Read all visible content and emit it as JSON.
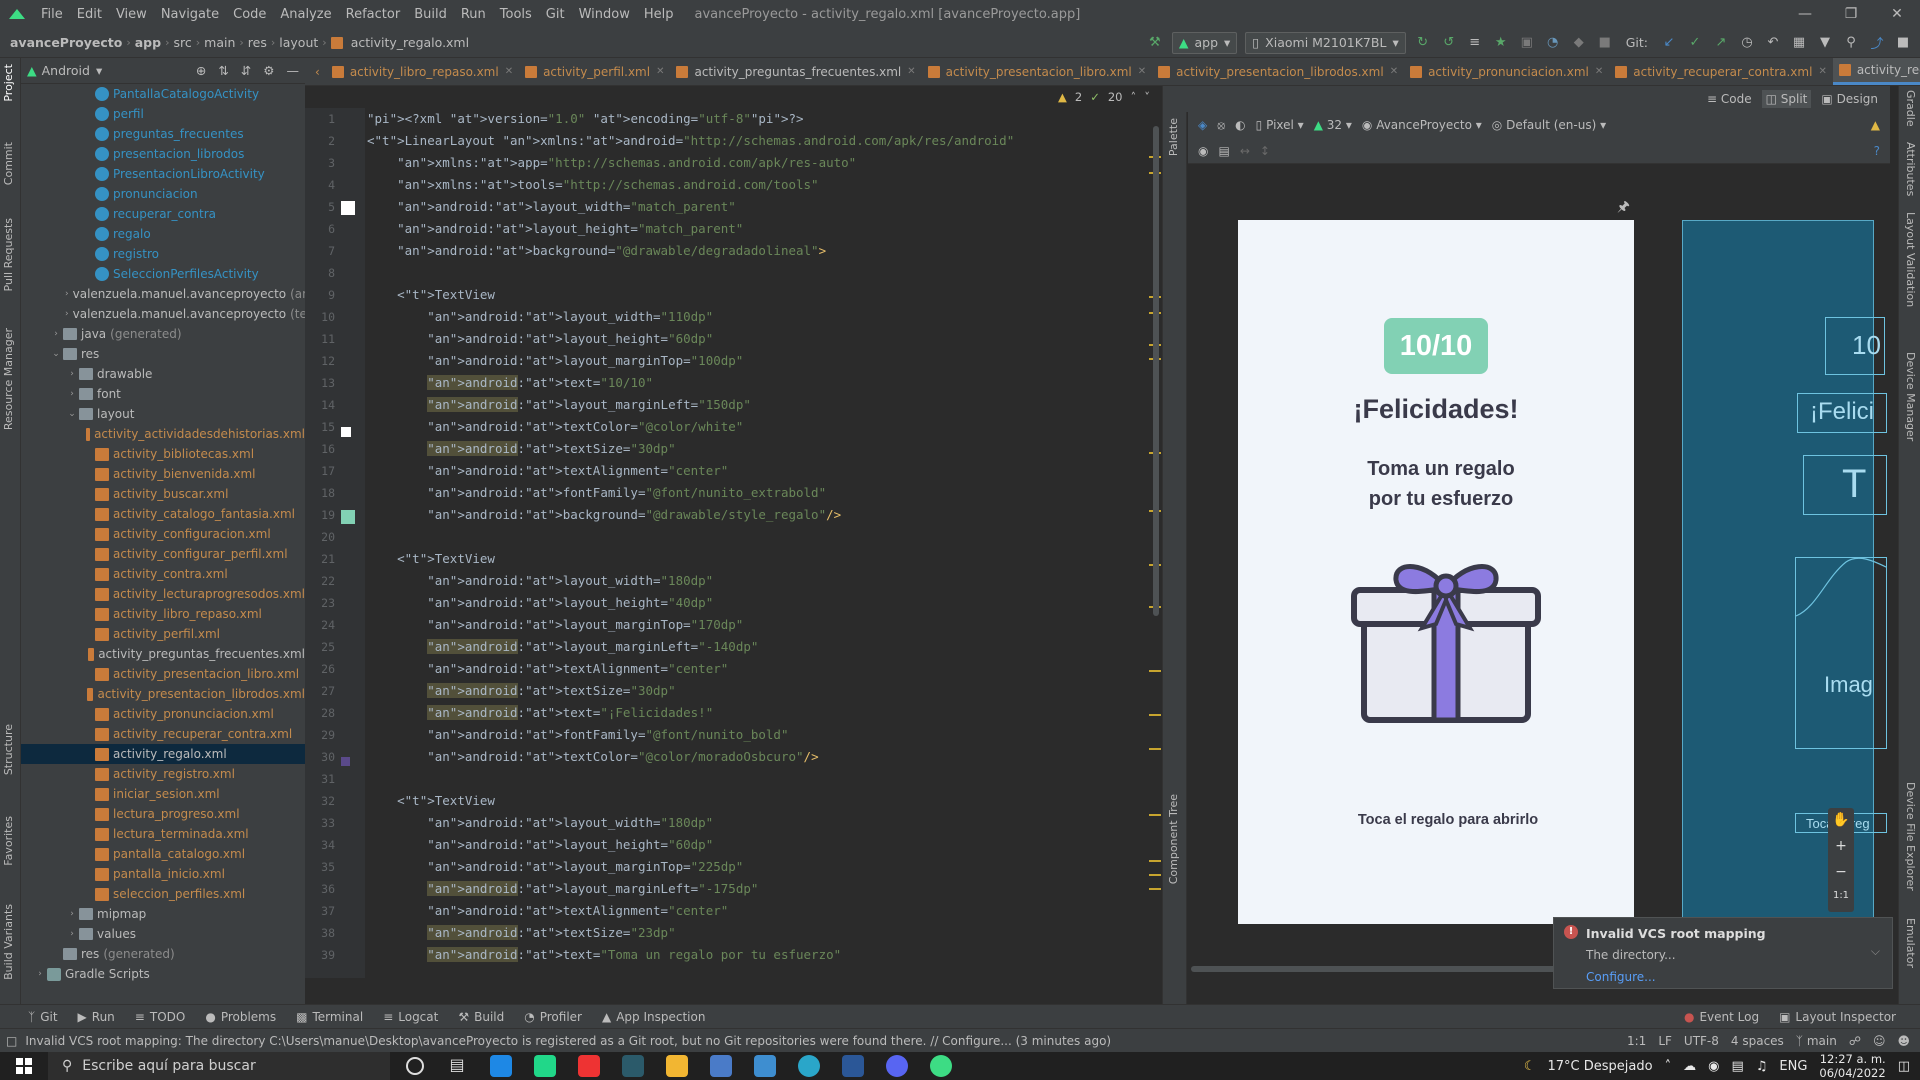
{
  "menubar": {
    "items": [
      "File",
      "Edit",
      "View",
      "Navigate",
      "Code",
      "Analyze",
      "Refactor",
      "Build",
      "Run",
      "Tools",
      "Git",
      "Window",
      "Help"
    ],
    "title": "avanceProyecto - activity_regalo.xml [avanceProyecto.app]"
  },
  "navbar": {
    "breadcrumbs": [
      "avanceProyecto",
      "app",
      "src",
      "main",
      "res",
      "layout",
      "activity_regalo.xml"
    ],
    "run_config": "app",
    "device": "Xiaomi M2101K7BL",
    "git_label": "Git:"
  },
  "left_stripe": [
    "Project",
    "Commit",
    "Pull Requests",
    "Resource Manager",
    "Structure",
    "Favorites",
    "Build Variants"
  ],
  "project": {
    "view": "Android",
    "tree": [
      {
        "label": "PantallaCatalogoActivity",
        "kind": "activity",
        "indent": 4
      },
      {
        "label": "perfil",
        "kind": "activity",
        "indent": 4
      },
      {
        "label": "preguntas_frecuentes",
        "kind": "activity",
        "indent": 4
      },
      {
        "label": "presentacion_librodos",
        "kind": "activity",
        "indent": 4
      },
      {
        "label": "PresentacionLibroActivity",
        "kind": "activity",
        "indent": 4
      },
      {
        "label": "pronunciacion",
        "kind": "activity",
        "indent": 4
      },
      {
        "label": "recuperar_contra",
        "kind": "activity",
        "indent": 4
      },
      {
        "label": "regalo",
        "kind": "activity",
        "indent": 4
      },
      {
        "label": "registro",
        "kind": "activity",
        "indent": 4
      },
      {
        "label": "SeleccionPerfilesActivity",
        "kind": "activity",
        "indent": 4
      },
      {
        "label": "valenzuela.manuel.avanceproyecto",
        "suffix": "(an",
        "kind": "package",
        "indent": 3,
        "arrow": "›"
      },
      {
        "label": "valenzuela.manuel.avanceproyecto",
        "suffix": "(te",
        "kind": "package",
        "indent": 3,
        "arrow": "›"
      },
      {
        "label": "java",
        "suffix": "(generated)",
        "kind": "folder",
        "indent": 2,
        "arrow": "›"
      },
      {
        "label": "res",
        "kind": "folder",
        "indent": 2,
        "arrow": "⌄"
      },
      {
        "label": "drawable",
        "kind": "folder",
        "indent": 3,
        "arrow": "›"
      },
      {
        "label": "font",
        "kind": "folder",
        "indent": 3,
        "arrow": "›"
      },
      {
        "label": "layout",
        "kind": "folder",
        "indent": 3,
        "arrow": "⌄"
      },
      {
        "label": "activity_actividadesdehistorias.xml",
        "kind": "xml",
        "indent": 4
      },
      {
        "label": "activity_bibliotecas.xml",
        "kind": "xml",
        "indent": 4
      },
      {
        "label": "activity_bienvenida.xml",
        "kind": "xml",
        "indent": 4
      },
      {
        "label": "activity_buscar.xml",
        "kind": "xml",
        "indent": 4
      },
      {
        "label": "activity_catalogo_fantasia.xml",
        "kind": "xml",
        "indent": 4
      },
      {
        "label": "activity_configuracion.xml",
        "kind": "xml",
        "indent": 4
      },
      {
        "label": "activity_configurar_perfil.xml",
        "kind": "xml",
        "indent": 4
      },
      {
        "label": "activity_contra.xml",
        "kind": "xml",
        "indent": 4
      },
      {
        "label": "activity_lecturaprogresodos.xml",
        "kind": "xml",
        "indent": 4
      },
      {
        "label": "activity_libro_repaso.xml",
        "kind": "xml",
        "indent": 4
      },
      {
        "label": "activity_perfil.xml",
        "kind": "xml",
        "indent": 4
      },
      {
        "label": "activity_preguntas_frecuentes.xml",
        "kind": "xml-plain",
        "indent": 4
      },
      {
        "label": "activity_presentacion_libro.xml",
        "kind": "xml",
        "indent": 4
      },
      {
        "label": "activity_presentacion_librodos.xml",
        "kind": "xml",
        "indent": 4
      },
      {
        "label": "activity_pronunciacion.xml",
        "kind": "xml",
        "indent": 4
      },
      {
        "label": "activity_recuperar_contra.xml",
        "kind": "xml",
        "indent": 4
      },
      {
        "label": "activity_regalo.xml",
        "kind": "xml-plain",
        "indent": 4,
        "selected": true
      },
      {
        "label": "activity_registro.xml",
        "kind": "xml",
        "indent": 4
      },
      {
        "label": "iniciar_sesion.xml",
        "kind": "xml",
        "indent": 4
      },
      {
        "label": "lectura_progreso.xml",
        "kind": "xml",
        "indent": 4
      },
      {
        "label": "lectura_terminada.xml",
        "kind": "xml",
        "indent": 4
      },
      {
        "label": "pantalla_catalogo.xml",
        "kind": "xml",
        "indent": 4
      },
      {
        "label": "pantalla_inicio.xml",
        "kind": "xml",
        "indent": 4
      },
      {
        "label": "seleccion_perfiles.xml",
        "kind": "xml",
        "indent": 4
      },
      {
        "label": "mipmap",
        "kind": "folder",
        "indent": 3,
        "arrow": "›"
      },
      {
        "label": "values",
        "kind": "folder",
        "indent": 3,
        "arrow": "›"
      },
      {
        "label": "res",
        "suffix": "(generated)",
        "kind": "folder",
        "indent": 2
      },
      {
        "label": "Gradle Scripts",
        "kind": "gradle",
        "indent": 1,
        "arrow": "›"
      }
    ]
  },
  "tabs": [
    {
      "label": "activity_libro_repaso.xml"
    },
    {
      "label": "activity_perfil.xml"
    },
    {
      "label": "activity_preguntas_frecuentes.xml",
      "plain": true
    },
    {
      "label": "activity_presentacion_libro.xml"
    },
    {
      "label": "activity_presentacion_librodos.xml"
    },
    {
      "label": "activity_pronunciacion.xml"
    },
    {
      "label": "activity_recuperar_contra.xml"
    },
    {
      "label": "activity_regalo.xml",
      "active": true
    }
  ],
  "editor": {
    "warnings": "2",
    "weak_warnings": "20",
    "lines": [
      "<?xml version=\"1.0\" encoding=\"utf-8\"?>",
      "<LinearLayout xmlns:android=\"http://schemas.android.com/apk/res/android\"",
      "    xmlns:app=\"http://schemas.android.com/apk/res-auto\"",
      "    xmlns:tools=\"http://schemas.android.com/tools\"",
      "    android:layout_width=\"match_parent\"",
      "    android:layout_height=\"match_parent\"",
      "    android:background=\"@drawable/degradadolineal\">",
      "",
      "    <TextView",
      "        android:layout_width=\"110dp\"",
      "        android:layout_height=\"60dp\"",
      "        android:layout_marginTop=\"100dp\"",
      "        android:text=\"10/10\"",
      "        android:layout_marginLeft=\"150dp\"",
      "        android:textColor=\"@color/white\"",
      "        android:textSize=\"30dp\"",
      "        android:textAlignment=\"center\"",
      "        android:fontFamily=\"@font/nunito_extrabold\"",
      "        android:background=\"@drawable/style_regalo\"/>",
      "",
      "    <TextView",
      "        android:layout_width=\"180dp\"",
      "        android:layout_height=\"40dp\"",
      "        android:layout_marginTop=\"170dp\"",
      "        android:layout_marginLeft=\"-140dp\"",
      "        android:textAlignment=\"center\"",
      "        android:textSize=\"30dp\"",
      "        android:text=\"¡Felicidades!\"",
      "        android:fontFamily=\"@font/nunito_bold\"",
      "        android:textColor=\"@color/moradoOsbcuro\"/>",
      "",
      "    <TextView",
      "        android:layout_width=\"180dp\"",
      "        android:layout_height=\"60dp\"",
      "        android:layout_marginTop=\"225dp\"",
      "        android:layout_marginLeft=\"-175dp\"",
      "        android:textAlignment=\"center\"",
      "        android:textSize=\"23dp\"",
      "        android:text=\"Toma un regalo por tu esfuerzo\""
    ],
    "highlighted_lines": [
      13,
      14,
      16,
      25,
      27,
      28,
      36,
      38,
      39
    ]
  },
  "design": {
    "modes": [
      "Code",
      "Split",
      "Design"
    ],
    "device": "Pixel",
    "api": "32",
    "theme": "AvanceProyecto",
    "locale": "Default (en-us)",
    "preview": {
      "score": "10/10",
      "congrats": "¡Felicidades!",
      "gift_text_line1": "Toma un regalo",
      "gift_text_line2": "por tu esfuerzo",
      "tap": "Toca el regalo para abrirlo"
    },
    "blueprint": {
      "score": "10",
      "congrats": "¡Felici",
      "gift_text": "T",
      "image": "Imag",
      "tap": "Toca el reg"
    },
    "zoom_ratio": "1:1",
    "palette_label": "Palette",
    "component_tree_label": "Component Tree"
  },
  "right_stripe": [
    "Gradle",
    "Attributes",
    "Layout Validation",
    "Device Manager",
    "Device File Explorer",
    "Emulator"
  ],
  "notification": {
    "title": "Invalid VCS root mapping",
    "body": "The directory...",
    "link": "Configure..."
  },
  "toolwindows": [
    "Git",
    "Run",
    "TODO",
    "Problems",
    "Terminal",
    "Logcat",
    "Build",
    "Profiler",
    "App Inspection"
  ],
  "toolwindows_right": [
    "Event Log",
    "Layout Inspector"
  ],
  "status": {
    "message": "Invalid VCS root mapping: The directory C:\\Users\\manue\\Desktop\\avanceProyecto is registered as a Git root, but no Git repositories were found there. // Configure... (3 minutes ago)",
    "position": "1:1",
    "line_sep": "LF",
    "encoding": "UTF-8",
    "indent": "4 spaces",
    "branch": "main"
  },
  "taskbar": {
    "search_placeholder": "Escribe aquí para buscar",
    "weather": "17°C  Despejado",
    "lang": "ENG",
    "time": "12:27 a. m.",
    "date": "06/04/2022"
  },
  "colors": {
    "accent": "#4a88c7",
    "score_bg": "#82d1b4",
    "gift_purple": "#8c7be0",
    "gift_outline": "#3a3a4a"
  }
}
